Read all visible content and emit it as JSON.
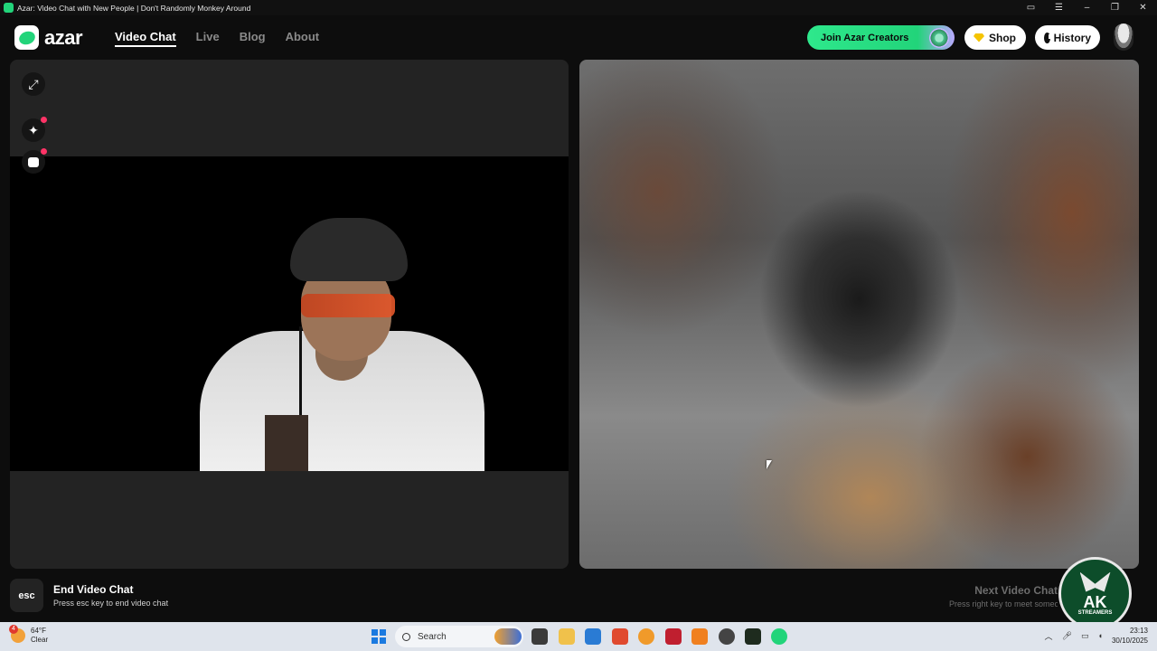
{
  "window": {
    "title": "Azar: Video Chat with New People | Don't Randomly Monkey Around",
    "controls": [
      "cast-icon",
      "menu-icon",
      "minimize",
      "restore",
      "close"
    ]
  },
  "nav": {
    "brand": "azar",
    "links": [
      {
        "label": "Video Chat",
        "active": true
      },
      {
        "label": "Live",
        "active": false
      },
      {
        "label": "Blog",
        "active": false
      },
      {
        "label": "About",
        "active": false
      }
    ],
    "join_creators": "Join Azar Creators",
    "shop": "Shop",
    "history": "History"
  },
  "local_tools": [
    "expand-icon",
    "sparkle-effects-icon",
    "face-filter-icon"
  ],
  "hints": {
    "esc_key": "esc",
    "end_title": "End Video Chat",
    "end_sub": "Press esc key to end video chat",
    "next_title": "Next Video Chat",
    "next_sub": "Press right key to meet someone new"
  },
  "watermark": {
    "big": "AK",
    "small": "STREAMERS"
  },
  "taskbar": {
    "weather_badge": "4",
    "temperature": "64°F",
    "condition": "Clear",
    "search_placeholder": "Search",
    "time": "23:13",
    "date": "30/10/2025"
  },
  "colors": {
    "accent_green": "#22d47a",
    "background": "#0d0d0d",
    "panel": "#232323",
    "notification_dot": "#ff3366"
  }
}
